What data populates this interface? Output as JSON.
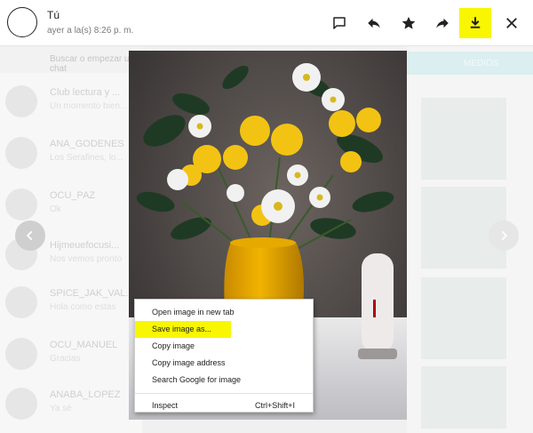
{
  "header": {
    "sender_name": "Tú",
    "timestamp": "ayer a la(s) 8:26 p. m.",
    "actions": [
      {
        "name": "comment",
        "icon": "comment-icon"
      },
      {
        "name": "reply",
        "icon": "reply-icon"
      },
      {
        "name": "star",
        "icon": "star-icon"
      },
      {
        "name": "forward",
        "icon": "forward-icon"
      },
      {
        "name": "download",
        "icon": "download-icon",
        "highlighted": true
      },
      {
        "name": "close",
        "icon": "close-icon"
      }
    ],
    "highlight_color": "#f8f600"
  },
  "background_chats": {
    "search_placeholder": "Buscar o empezar un chat",
    "items": [
      {
        "name": "Club lectura y ...",
        "snippet": "Un momento bien..."
      },
      {
        "name": "ANA_GODENES",
        "snippet": "Los Serafines, lo..."
      },
      {
        "name": "OCU_PAZ",
        "snippet": "Ok"
      },
      {
        "name": "Hijmeuefocusi...",
        "snippet": "Nos vemos pronto"
      },
      {
        "name": "SPICE_JAK_VAL...",
        "snippet": "Hola como estas"
      },
      {
        "name": "OCU_MANUEL",
        "snippet": "Gracias"
      },
      {
        "name": "ANABA_LOPEZ",
        "snippet": "Ya sé"
      }
    ],
    "right_tab_label": "MEDIOS"
  },
  "viewer": {
    "image_description_icon": "flower-vase-photo",
    "prev_icon": "chevron-left-icon",
    "next_icon": "chevron-right-icon"
  },
  "context_menu": {
    "items": [
      {
        "label": "Open image in new tab",
        "shortcut": ""
      },
      {
        "label": "Save image as...",
        "shortcut": "",
        "highlighted": true
      },
      {
        "label": "Copy image",
        "shortcut": ""
      },
      {
        "label": "Copy image address",
        "shortcut": ""
      },
      {
        "label": "Search Google for image",
        "shortcut": ""
      },
      {
        "label": "Inspect",
        "shortcut": "Ctrl+Shift+I"
      }
    ]
  }
}
